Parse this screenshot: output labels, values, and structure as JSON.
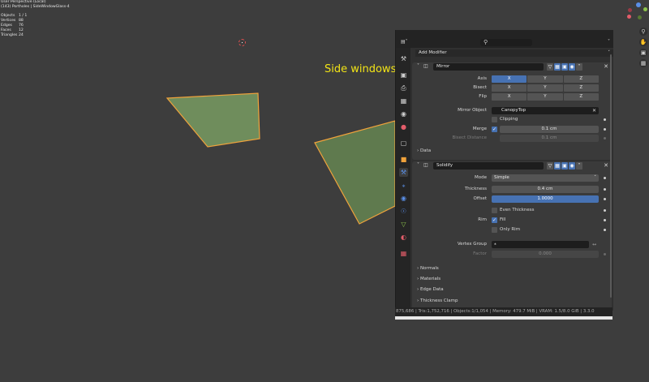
{
  "viewport": {
    "view_name": "User Perspective (Local)",
    "object_info": "(143) Portholes | SideWindowGlass-4",
    "stats": [
      {
        "key": "Objects",
        "value": "1 / 1"
      },
      {
        "key": "Vertices",
        "value": "88"
      },
      {
        "key": "Edges",
        "value": "76"
      },
      {
        "key": "Faces",
        "value": "12"
      },
      {
        "key": "Triangles",
        "value": "24"
      }
    ],
    "overlay_label": "Side windows"
  },
  "gizmo": {
    "colors": {
      "x": "#e35d6a",
      "y": "#8cc34c",
      "z": "#5a8fe6",
      "neg_x": "#9a3a45",
      "neg_y": "#587a32"
    },
    "nav_icons": [
      "zoom-icon",
      "hand-icon",
      "camera-icon",
      "grid-icon"
    ]
  },
  "properties": {
    "add_modifier": "Add Modifier",
    "tabs": [
      "tool-icon",
      "render-icon",
      "output-icon",
      "view-layer-icon",
      "scene-icon",
      "world-icon",
      "collection-icon",
      "object-icon",
      "modifier-icon",
      "particles-icon",
      "physics-icon",
      "constraints-icon",
      "data-icon",
      "material-icon",
      "texture-icon"
    ],
    "mirror": {
      "name": "Mirror",
      "axis_label": "Axis",
      "bisect_label": "Bisect",
      "flip_label": "Flip",
      "axes": [
        "X",
        "Y",
        "Z"
      ],
      "mirror_object_label": "Mirror Object",
      "mirror_object_value": "CanopyTop",
      "clipping_label": "Clipping",
      "merge_label": "Merge",
      "merge_value": "0.1 cm",
      "bisect_distance_label": "Bisect Distance",
      "bisect_distance_value": "0.1 cm",
      "data_label": "Data"
    },
    "solidify": {
      "name": "Solidify",
      "mode_label": "Mode",
      "mode_value": "Simple",
      "thickness_label": "Thickness",
      "thickness_value": "0.4 cm",
      "offset_label": "Offset",
      "offset_value": "1.0000",
      "even_thickness_label": "Even Thickness",
      "rim_label": "Rim",
      "fill_label": "Fill",
      "only_rim_label": "Only Rim",
      "vertex_group_label": "Vertex Group",
      "factor_label": "Factor",
      "factor_value": "0.000",
      "subpanels": [
        "Normals",
        "Materials",
        "Edge Data",
        "Thickness Clamp"
      ]
    },
    "status_bar": "875,686 | Tris:1,752,716 | Objects:1/1,054 | Memory: 479.7 MiB | VRAM: 1.5/8.0 GiB | 3.3.0"
  }
}
